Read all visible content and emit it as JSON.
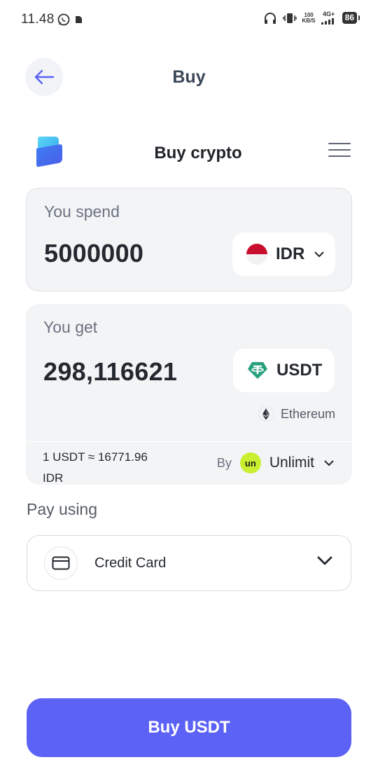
{
  "status_bar": {
    "time": "11.48",
    "net_speed_value": "100",
    "net_speed_unit": "KB/S",
    "network_type": "4G+",
    "battery": "86"
  },
  "header": {
    "title": "Buy"
  },
  "widget": {
    "title": "Buy crypto"
  },
  "spend": {
    "label": "You spend",
    "amount": "5000000",
    "currency": "IDR"
  },
  "get": {
    "label": "You get",
    "amount": "298,116621",
    "currency": "USDT",
    "network": "Ethereum",
    "rate_line1": "1 USDT ≈ 16771.96",
    "rate_line2": "IDR",
    "by_label": "By",
    "provider_logo_text": "un",
    "provider": "Unlimit"
  },
  "payment": {
    "label": "Pay using",
    "method": "Credit Card"
  },
  "cta": {
    "label": "Buy USDT"
  },
  "colors": {
    "accent": "#5b62f5",
    "tether": "#26a17b",
    "unlimit": "#c8f031"
  }
}
